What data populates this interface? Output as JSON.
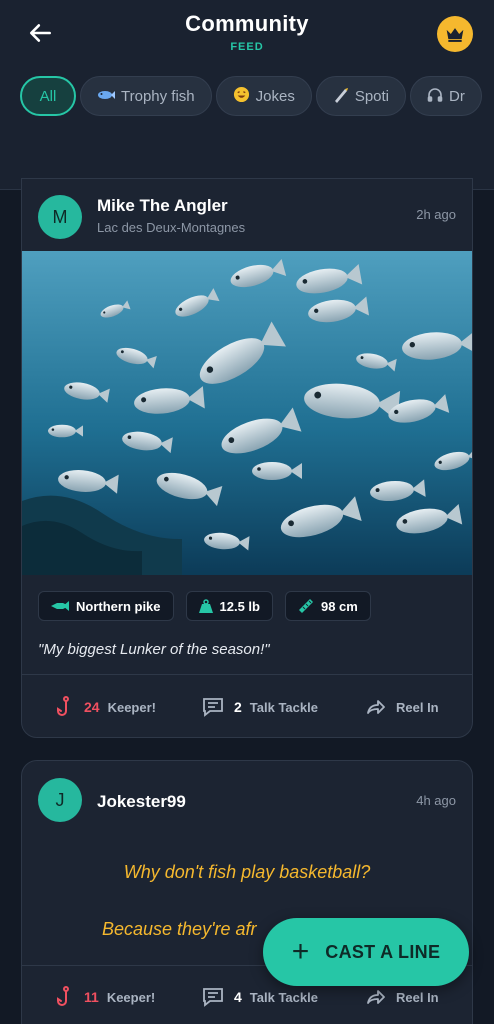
{
  "header": {
    "title": "Community",
    "subtitle": "FEED",
    "accent_color": "#26c6a6",
    "crown_color": "#f5b82e"
  },
  "filters": [
    {
      "label": "All",
      "icon": "none",
      "active": true
    },
    {
      "label": "Trophy fish",
      "icon": "fish-icon"
    },
    {
      "label": "Jokes",
      "icon": "laugh-emoji-icon"
    },
    {
      "label": "Spoti",
      "icon": "spotlight-icon"
    },
    {
      "label": "Dr",
      "icon": "headphones-icon"
    }
  ],
  "posts": [
    {
      "avatar_letter": "M",
      "author": "Mike The Angler",
      "location": "Lac des Deux-Montagnes",
      "time": "2h ago",
      "tags": [
        {
          "label": "Northern pike",
          "icon": "fish-icon"
        },
        {
          "label": "12.5 lb",
          "icon": "weight-icon"
        },
        {
          "label": "98 cm",
          "icon": "ruler-icon"
        }
      ],
      "caption": "\"My biggest Lunker of the season!\"",
      "keeper_count": "24",
      "keeper_label": "Keeper!",
      "comment_count": "2",
      "comment_label": "Talk Tackle",
      "share_label": "Reel In"
    },
    {
      "avatar_letter": "J",
      "author": "Jokester99",
      "time": "4h ago",
      "joke_line1": "Why don't fish play basketball?",
      "joke_line2": "Because they're afr",
      "keeper_count": "11",
      "keeper_label": "Keeper!",
      "comment_count": "4",
      "comment_label": "Talk Tackle",
      "share_label": "Reel In"
    }
  ],
  "fab": {
    "label": "CAST A LINE"
  }
}
